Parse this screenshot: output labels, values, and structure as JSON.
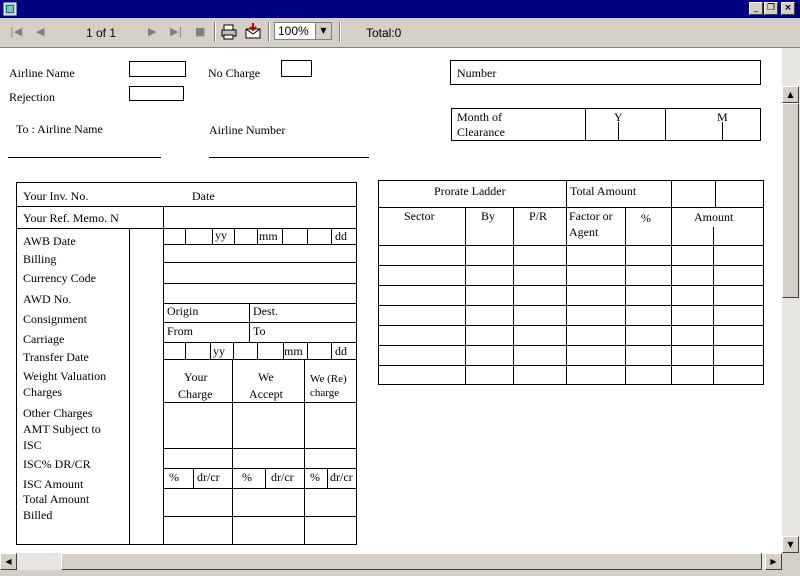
{
  "window": {
    "minimize": "_",
    "restore": "❐",
    "close": "×"
  },
  "toolbar": {
    "page_indicator": "1 of 1",
    "zoom": "100%",
    "total": "Total:0"
  },
  "form": {
    "airline_name": "Airline Name",
    "no_charge": "No Charge",
    "rejection": "Rejection",
    "number": "Number",
    "to_airline_name": "To : Airline Name",
    "airline_number": "Airline Number",
    "month_of": "Month of",
    "clearance": "Clearance",
    "y": "Y",
    "m": "M",
    "left_table": {
      "your_inv_no": "Your Inv. No.",
      "date": "Date",
      "your_ref_memo": "Your Ref. Memo. N",
      "yy": "yy",
      "mm": "mm",
      "dd": "dd",
      "rows": [
        "AWB Date",
        "Billing",
        "Currency Code",
        "AWD No.",
        "Consignment",
        "Carriage",
        "Transfer Date",
        "Weight Valuation",
        "Charges",
        "Other Charges",
        "AMT Subject to",
        "ISC",
        "ISC% DR/CR",
        "ISC Amount",
        "Total Amount",
        "Billed"
      ],
      "origin": "Origin",
      "dest": "Dest.",
      "from": "From",
      "to": "To",
      "your_charge_1": "Your",
      "your_charge_2": "Charge",
      "we_accept_1": "We",
      "we_accept_2": "Accept",
      "we_recharge_1": "We (Re)",
      "we_recharge_2": "charge",
      "pct": "%",
      "drcr": "dr/cr"
    },
    "right_table": {
      "prorate_ladder": "Prorate Ladder",
      "total_amount": "Total Amount",
      "sector": "Sector",
      "by": "By",
      "pr": "P/R",
      "factor_1": "Factor  or",
      "factor_2": "Agent",
      "pct": "%",
      "amount": "Amount"
    }
  }
}
